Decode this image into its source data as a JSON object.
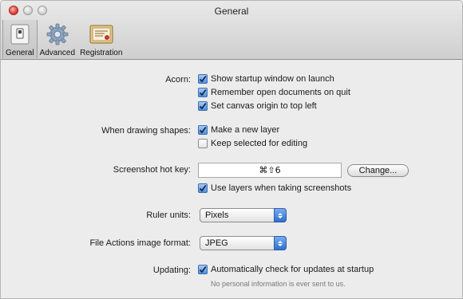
{
  "window": {
    "title": "General"
  },
  "toolbar": {
    "items": [
      {
        "label": "General",
        "icon": "switch-icon",
        "selected": true
      },
      {
        "label": "Advanced",
        "icon": "gear-icon",
        "selected": false
      },
      {
        "label": "Registration",
        "icon": "certificate-icon",
        "selected": false
      }
    ]
  },
  "acorn": {
    "label": "Acorn:",
    "options": [
      {
        "text": "Show startup window on launch",
        "checked": true
      },
      {
        "text": "Remember open documents on quit",
        "checked": true
      },
      {
        "text": "Set canvas origin to top left",
        "checked": true
      }
    ]
  },
  "drawing": {
    "label": "When drawing shapes:",
    "options": [
      {
        "text": "Make a new layer",
        "checked": true
      },
      {
        "text": "Keep selected for editing",
        "checked": false
      }
    ]
  },
  "hotkey": {
    "label": "Screenshot hot key:",
    "value": "⌘⇧6",
    "change_label": "Change...",
    "layers_option": {
      "text": "Use layers when taking screenshots",
      "checked": true
    }
  },
  "ruler": {
    "label": "Ruler units:",
    "value": "Pixels"
  },
  "file_actions": {
    "label": "File Actions image format:",
    "value": "JPEG"
  },
  "updating": {
    "label": "Updating:",
    "option": {
      "text": "Automatically check for updates at startup",
      "checked": true
    },
    "note": "No personal information is ever sent to us."
  },
  "colors": {
    "accent": "#4b8fe0",
    "close_button": "#e0443a"
  }
}
